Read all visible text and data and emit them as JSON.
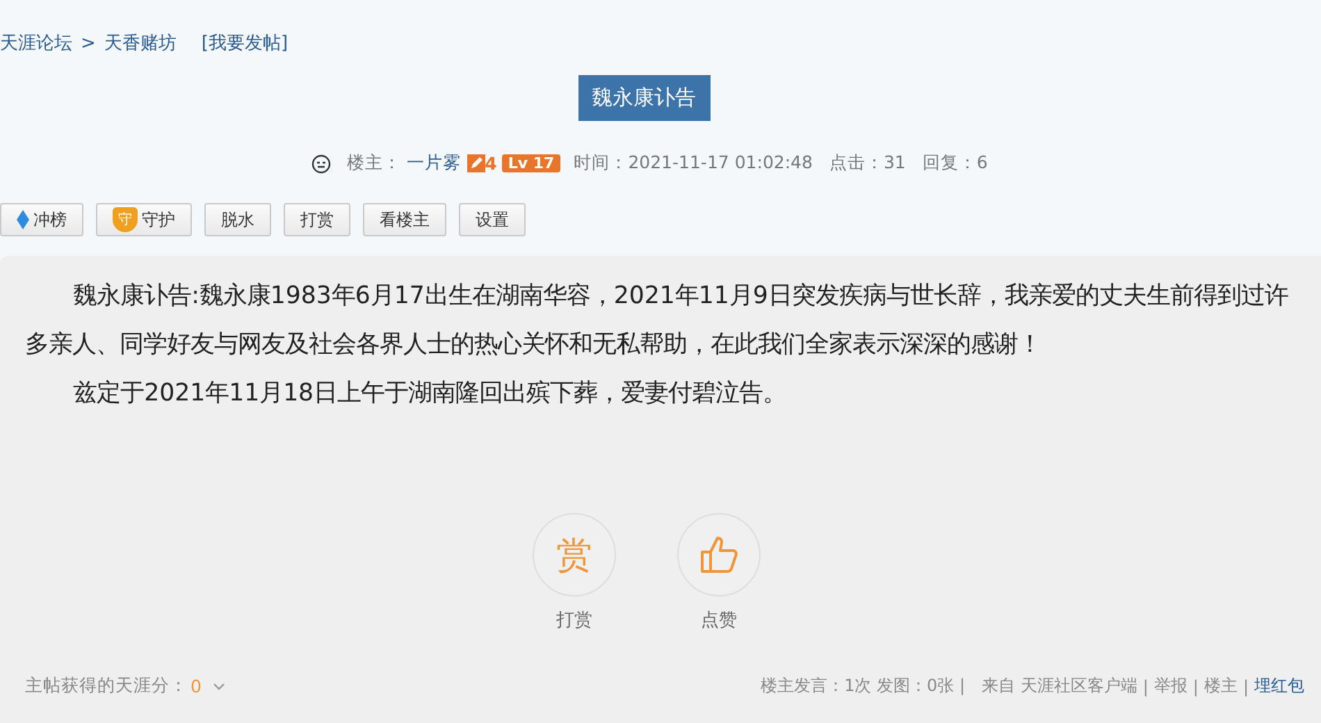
{
  "breadcrumb": {
    "items": [
      "天涯论坛",
      ">",
      "天香赌坊"
    ],
    "post_link": "[我要发帖]"
  },
  "title": "魏永康讣告",
  "meta": {
    "host_label": "楼主：",
    "host_name": "一片雾",
    "edit_count": "4",
    "level_badge": "Lv 17",
    "time": "时间：2021-11-17 01:02:48",
    "clicks": "点击：31",
    "replies": "回复：6"
  },
  "toolbar": [
    {
      "kind": "boost",
      "label": "冲榜"
    },
    {
      "kind": "guard",
      "badge": "守",
      "label": "守护"
    },
    {
      "kind": "plain",
      "label": "脱水"
    },
    {
      "kind": "plain",
      "label": "打赏"
    },
    {
      "kind": "plain",
      "label": "看楼主"
    },
    {
      "kind": "plain",
      "label": "设置"
    }
  ],
  "paragraphs": [
    "魏永康讣告:魏永康1983年6月17出生在湖南华容，2021年11月9日突发疾病与世长辞，我亲爱的丈夫生前得到过许多亲人、同学好友与网友及社会各界人士的热心关怀和无私帮助，在此我们全家表示深深的感谢！",
    "兹定于2021年11月18日上午于湖南隆回出殡下葬，爱妻付碧泣告。"
  ],
  "actions": [
    {
      "kind": "reward",
      "glyph": "赏",
      "label": "打赏"
    },
    {
      "kind": "like",
      "label": "点赞"
    }
  ],
  "footer": {
    "score_label": "主帖获得的天涯分：",
    "score": "0",
    "stats": "楼主发言：1次 发图：0张 |",
    "source": "来自 天涯社区客户端",
    "links": [
      {
        "kind": "sep",
        "text": "|"
      },
      {
        "kind": "link",
        "text": "举报"
      },
      {
        "kind": "sep",
        "text": "|"
      },
      {
        "kind": "link",
        "text": "楼主"
      },
      {
        "kind": "sep",
        "text": "|"
      },
      {
        "kind": "accent",
        "text": "埋红包"
      }
    ]
  }
}
